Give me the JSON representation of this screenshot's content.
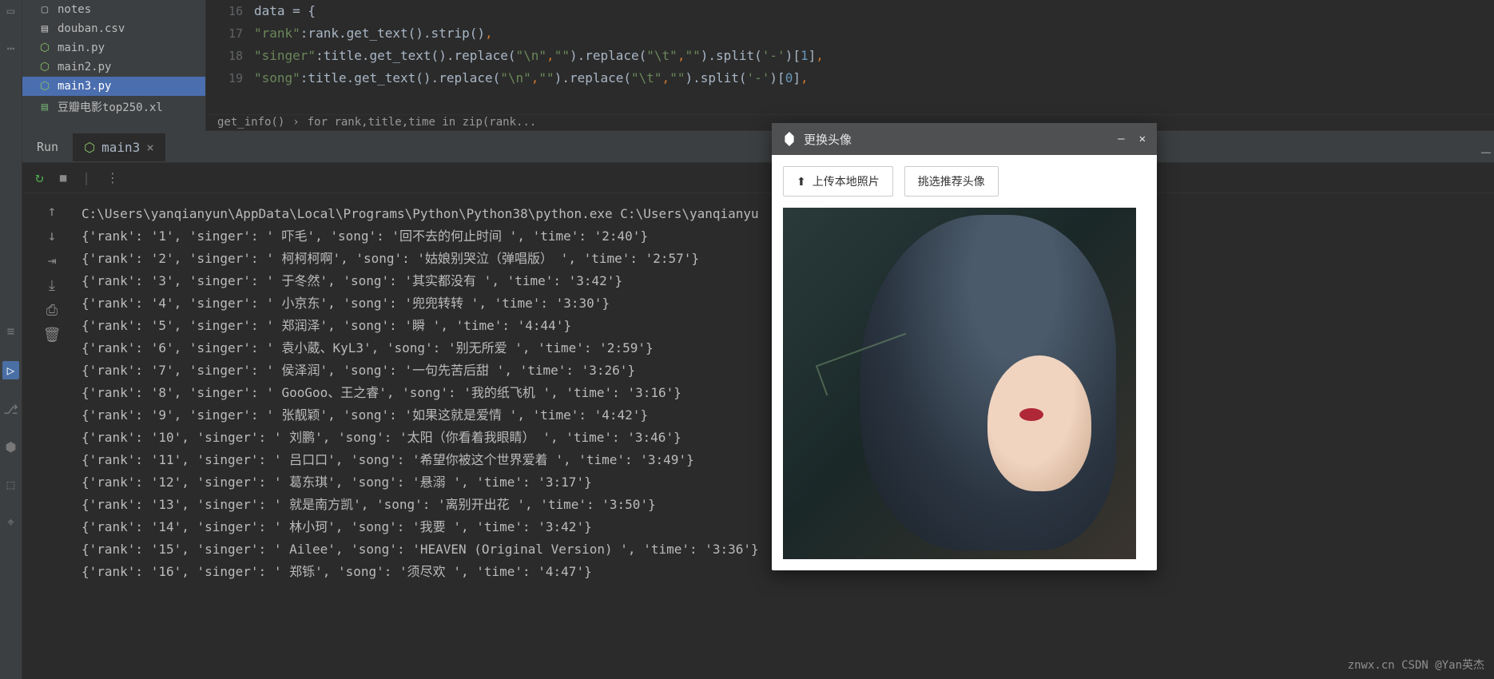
{
  "sidebar": {
    "items": [
      {
        "icon": "folder",
        "label": "notes"
      },
      {
        "icon": "csv",
        "label": "douban.csv"
      },
      {
        "icon": "py",
        "label": "main.py"
      },
      {
        "icon": "py",
        "label": "main2.py"
      },
      {
        "icon": "py",
        "label": "main3.py",
        "selected": true
      },
      {
        "icon": "xls",
        "label": "豆瓣电影top250.xl"
      }
    ]
  },
  "editor": {
    "gutter": [
      "16",
      "17",
      "18",
      "19"
    ],
    "lines": [
      {
        "indent": "                ",
        "html": "data = {"
      },
      {
        "indent": "                    ",
        "html": "<span class='str'>\"rank\"</span>:rank.get_text().strip()<span class='kw'>,</span>"
      },
      {
        "indent": "                    ",
        "html": "<span class='str'>\"singer\"</span>:title.get_text().replace(<span class='str'>\"\\n\"</span><span class='kw'>,</span><span class='str'>\"\"</span>).replace(<span class='str'>\"\\t\"</span><span class='kw'>,</span><span class='str'>\"\"</span>).split(<span class='str'>'-'</span>)[<span class='num'>1</span>]<span class='kw'>,</span>"
      },
      {
        "indent": "                    ",
        "html": "<span class='str'>\"song\"</span>:title.get_text().replace(<span class='str'>\"\\n\"</span><span class='kw'>,</span><span class='str'>\"\"</span>).replace(<span class='str'>\"\\t\"</span><span class='kw'>,</span><span class='str'>\"\"</span>).split(<span class='str'>'-'</span>)[<span class='num'>0</span>]<span class='kw'>,</span>"
      }
    ],
    "breadcrumb": [
      "get_info()",
      "for rank,title,time in zip(rank..."
    ]
  },
  "run": {
    "label": "Run",
    "tab": "main3",
    "exec_path": "C:\\Users\\yanqianyun\\AppData\\Local\\Programs\\Python\\Python38\\python.exe C:\\Users\\yanqianyu",
    "rows": [
      {
        "rank": "1",
        "singer": " 吓毛",
        "song": "回不去的何止时间 ",
        "time": "2:40"
      },
      {
        "rank": "2",
        "singer": " 柯柯柯啊",
        "song": "姑娘别哭泣（弹唱版） ",
        "time": "2:57"
      },
      {
        "rank": "3",
        "singer": " 于冬然",
        "song": "其实都没有 ",
        "time": "3:42"
      },
      {
        "rank": "4",
        "singer": " 小京东",
        "song": "兜兜转转 ",
        "time": "3:30"
      },
      {
        "rank": "5",
        "singer": " 郑润泽",
        "song": "瞬 ",
        "time": "4:44"
      },
      {
        "rank": "6",
        "singer": " 袁小葳、KyL3",
        "song": "别无所爱 ",
        "time": "2:59"
      },
      {
        "rank": "7",
        "singer": " 侯泽润",
        "song": "一句先苦后甜 ",
        "time": "3:26"
      },
      {
        "rank": "8",
        "singer": " GooGoo、王之睿",
        "song": "我的纸飞机 ",
        "time": "3:16"
      },
      {
        "rank": "9",
        "singer": " 张靓颖",
        "song": "如果这就是爱情 ",
        "time": "4:42"
      },
      {
        "rank": "10",
        "singer": " 刘鹏",
        "song": "太阳（你看着我眼睛） ",
        "time": "3:46"
      },
      {
        "rank": "11",
        "singer": " 吕口口",
        "song": "希望你被这个世界爱着 ",
        "time": "3:49"
      },
      {
        "rank": "12",
        "singer": " 葛东琪",
        "song": "悬溺 ",
        "time": "3:17"
      },
      {
        "rank": "13",
        "singer": " 就是南方凯",
        "song": "离别开出花 ",
        "time": "3:50"
      },
      {
        "rank": "14",
        "singer": " 林小珂",
        "song": "我要 ",
        "time": "3:42"
      },
      {
        "rank": "15",
        "singer": " Ailee",
        "song": "HEAVEN (Original Version) ",
        "time": "3:36"
      },
      {
        "rank": "16",
        "singer": " 郑铄",
        "song": "须尽欢 ",
        "time": "4:47"
      }
    ]
  },
  "dialog": {
    "title": "更换头像",
    "upload_btn": "上传本地照片",
    "recommend_btn": "挑选推荐头像"
  },
  "watermark": "znwx.cn\nCSDN @Yan英杰"
}
